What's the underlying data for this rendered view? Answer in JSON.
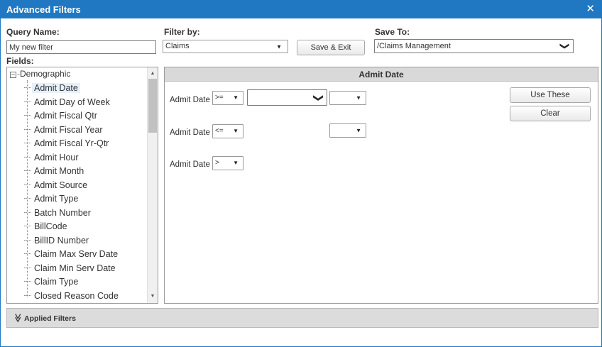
{
  "dialog": {
    "title": "Advanced Filters",
    "close_glyph": "✕"
  },
  "query": {
    "label": "Query Name:",
    "value": "My new filter"
  },
  "filter_by": {
    "label": "Filter by:",
    "value": "Claims",
    "arrow": "▼"
  },
  "save_exit": {
    "label": "Save & Exit"
  },
  "save_to": {
    "label": "Save To:",
    "value": "/Claims Management",
    "arrow": "❯"
  },
  "fields": {
    "label": "Fields:",
    "root": {
      "expander": "−",
      "label": "Demographic"
    },
    "items": [
      {
        "label": "Admit Date",
        "selected": true
      },
      {
        "label": "Admit Day of Week"
      },
      {
        "label": "Admit Fiscal Qtr"
      },
      {
        "label": "Admit Fiscal Year"
      },
      {
        "label": "Admit Fiscal Yr-Qtr"
      },
      {
        "label": "Admit Hour"
      },
      {
        "label": "Admit Month"
      },
      {
        "label": "Admit Source"
      },
      {
        "label": "Admit Type"
      },
      {
        "label": "Batch Number"
      },
      {
        "label": "BillCode"
      },
      {
        "label": "BillID Number"
      },
      {
        "label": "Claim Max Serv Date"
      },
      {
        "label": "Claim Min Serv Date"
      },
      {
        "label": "Claim Type"
      },
      {
        "label": "Closed Reason Code"
      }
    ],
    "scroll_up": "▲",
    "scroll_down": "▼"
  },
  "criteria": {
    "header": "Admit Date",
    "rows": [
      {
        "field": "Admit Date",
        "operator": ">=",
        "value": ""
      },
      {
        "field": "Admit Date",
        "operator": "<=",
        "value": ""
      },
      {
        "field": "Admit Date",
        "operator": ">",
        "value": ""
      }
    ],
    "arrow": "▼",
    "value_arrow": "❯",
    "use_these": "Use These",
    "clear": "Clear"
  },
  "applied_filters": {
    "label": "Applied Filters",
    "chevron": "≫"
  },
  "colors": {
    "titlebar": "#1f78c1",
    "header_bg": "#d9d9d9",
    "selected_bg": "#e5f1fb"
  },
  "icons": [
    "close-icon",
    "dropdown-arrow-icon",
    "tree-collapse-icon",
    "double-chevron-down-icon"
  ]
}
